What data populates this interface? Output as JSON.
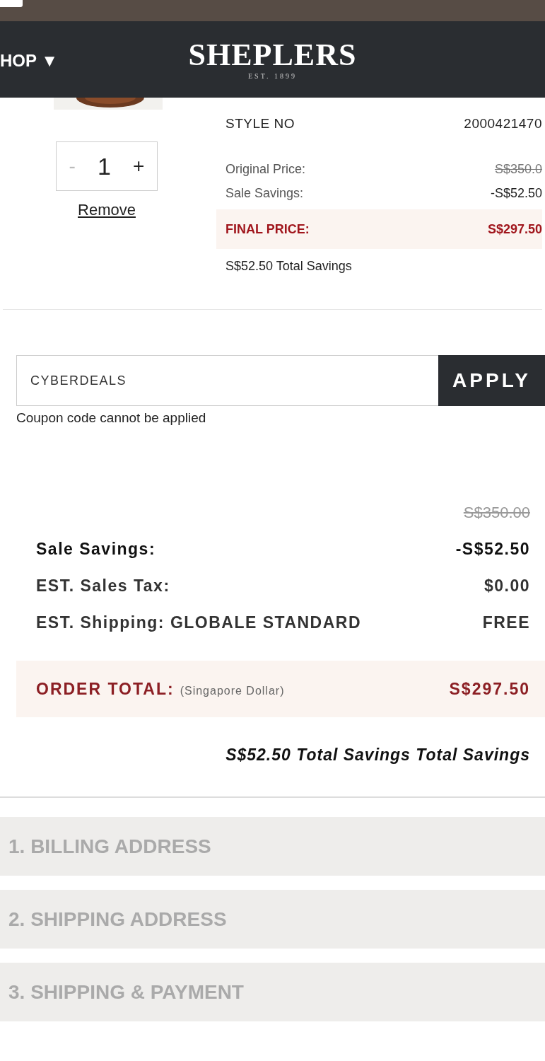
{
  "header": {
    "menu_label": "HOP ▼",
    "logo": "SHEPLERS",
    "logo_tagline": "EST. 1899"
  },
  "item": {
    "details": [
      {
        "label": "STYLE NO",
        "value": "2000421470"
      }
    ],
    "quantity": "1",
    "minus": "-",
    "plus": "+",
    "remove": "Remove",
    "prices": [
      {
        "label": "Original Price:",
        "value": "S$350.0",
        "kind": "strike"
      },
      {
        "label": "Sale Savings:",
        "value": "-S$52.50",
        "kind": "plain"
      }
    ],
    "final": {
      "label": "FINAL PRICE:",
      "value": "S$297.50"
    },
    "savings": "S$52.50  Total Savings"
  },
  "coupon": {
    "value": "CYBERDEALS",
    "button": "APPLY",
    "error": "Coupon code cannot be applied"
  },
  "summary": {
    "original": "S$350.00",
    "rows": [
      {
        "label": "Sale Savings:",
        "value": "-S$52.50"
      },
      {
        "label": "EST. Sales Tax:",
        "value": "$0.00"
      },
      {
        "label": "EST. Shipping: GLOBALE STANDARD",
        "value": "FREE"
      }
    ],
    "total": {
      "label": "ORDER TOTAL:",
      "currency": "(Singapore Dollar)",
      "value": "S$297.50"
    },
    "savings": "S$52.50 Total Savings Total Savings"
  },
  "steps": [
    {
      "label": "1. BILLING ADDRESS",
      "expanded": false
    },
    {
      "label": "2. SHIPPING ADDRESS",
      "expanded": false
    },
    {
      "label": "3. SHIPPING & PAYMENT",
      "expanded": false
    }
  ]
}
